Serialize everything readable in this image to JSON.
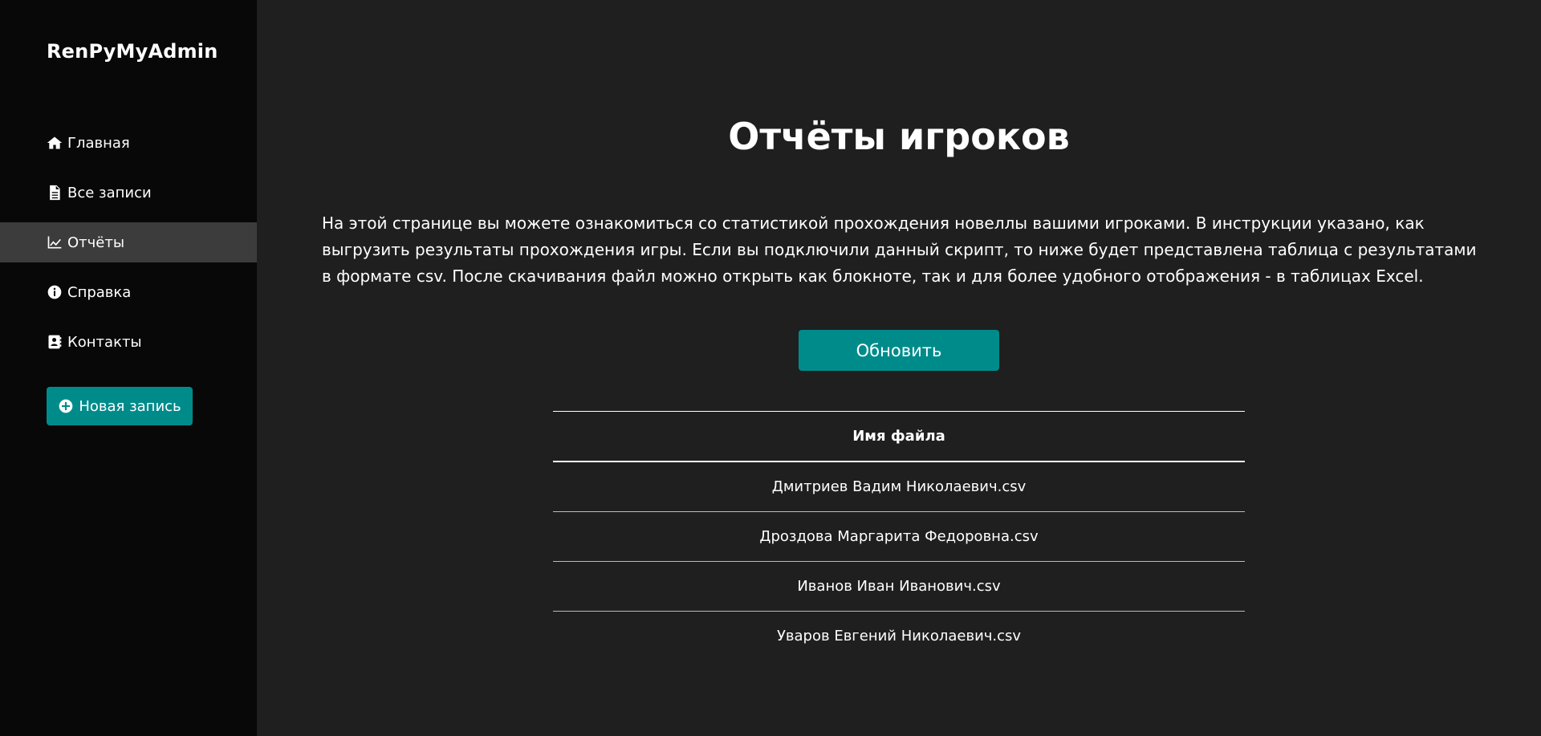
{
  "sidebar": {
    "brand": "RenPyMyAdmin",
    "items": [
      {
        "label": "Главная",
        "icon": "home-icon"
      },
      {
        "label": "Все записи",
        "icon": "file-icon"
      },
      {
        "label": "Отчёты",
        "icon": "chart-line-icon",
        "active": true
      },
      {
        "label": "Справка",
        "icon": "info-circle-icon"
      },
      {
        "label": "Контакты",
        "icon": "address-book-icon"
      }
    ],
    "new_entry_label": "Новая запись"
  },
  "main": {
    "title": "Отчёты игроков",
    "intro": "На этой странице вы можете ознакомиться со статистикой прохождения новеллы вашими игроками. В инструкции указано, как выгрузить результаты прохождения игры. Если вы подключили данный скрипт, то ниже будет представлена таблица с результатами в формате csv. После скачивания файл можно открыть как блокноте, так и для более удобного отображения - в таблицах Excel.",
    "refresh_label": "Обновить",
    "table": {
      "header": "Имя файла",
      "rows": [
        "Дмитриев Вадим Николаевич.csv",
        "Дроздова Маргарита Федоровна.csv",
        "Иванов Иван Иванович.csv",
        "Уваров Евгений Николаевич.csv"
      ]
    }
  },
  "colors": {
    "sidebar_bg": "#080808",
    "main_bg": "#1f1f1f",
    "active_item_bg": "#3c3c3c",
    "accent": "#008b8b"
  }
}
